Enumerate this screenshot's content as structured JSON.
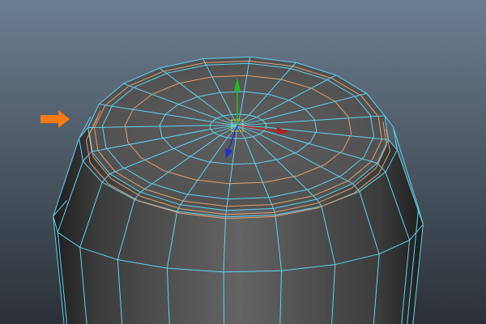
{
  "viewport": {
    "background_top": "#6b7e91",
    "background_bottom": "#2b3036",
    "wire_color": "#5fd3ee",
    "selected_edge_color": "#e0a070",
    "face_color": "#5a5a5a",
    "radial_segments": 20
  },
  "manipulator": {
    "x_axis_color": "#c02020",
    "y_axis_color": "#20c020",
    "z_axis_color": "#2030d0",
    "center_color": "#e0e020"
  },
  "annotation": {
    "arrow_color": "#ff7a10",
    "icon": "arrow-right-icon"
  }
}
